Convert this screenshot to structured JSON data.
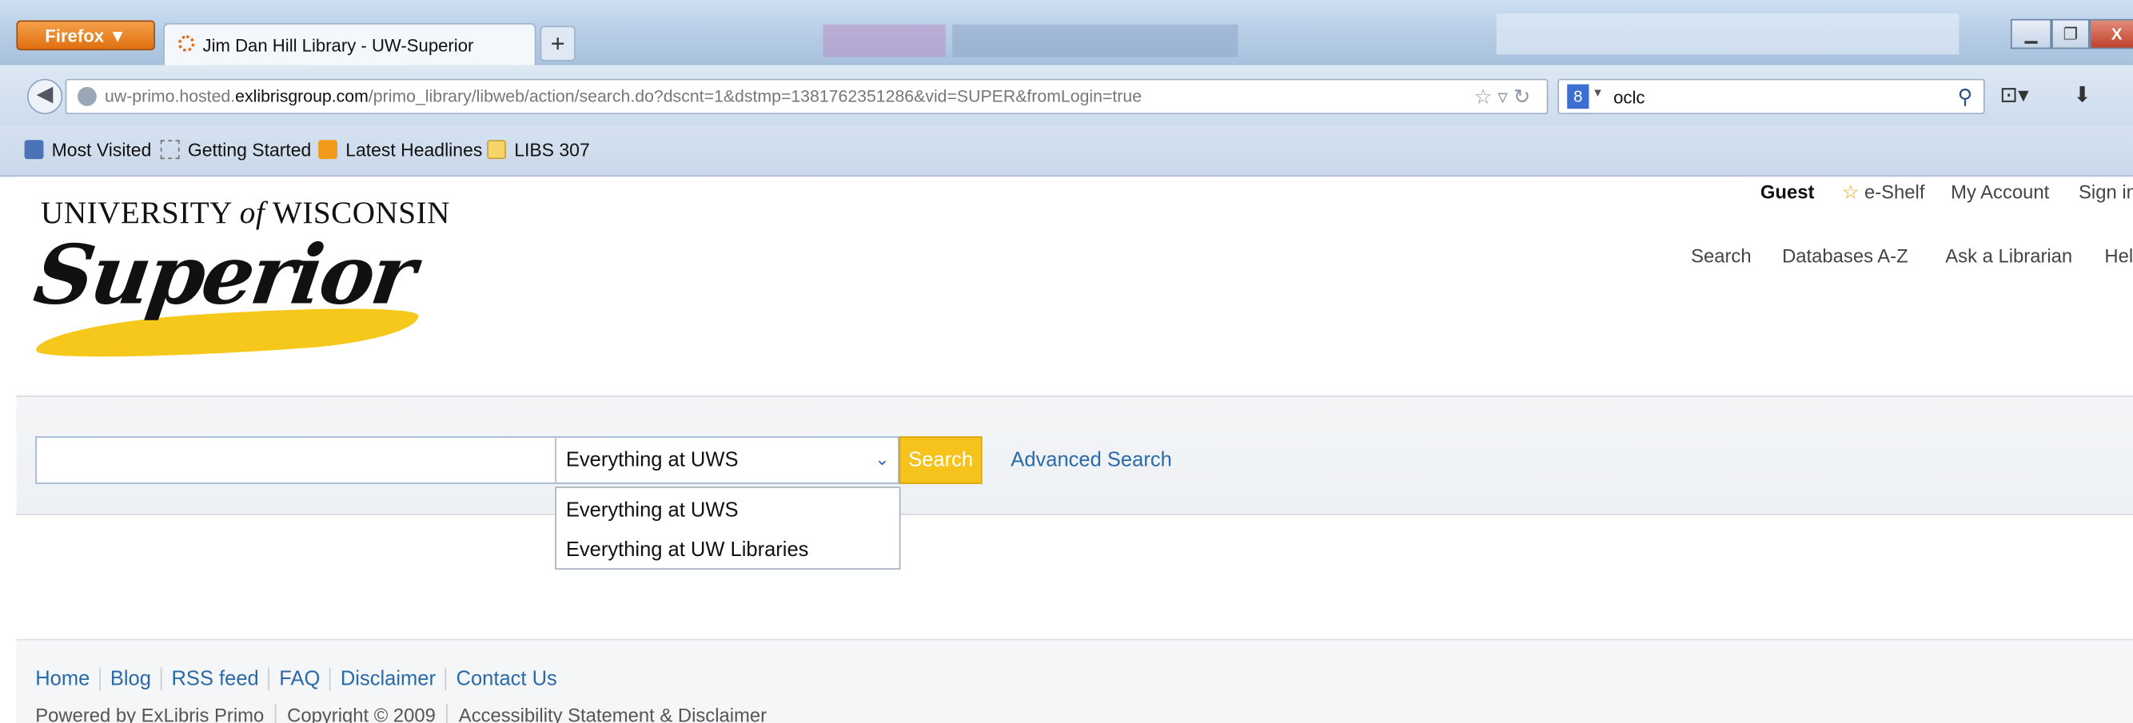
{
  "browser": {
    "menu_button": "Firefox ▼",
    "tab_title": "Jim Dan Hill Library - UW-Superior",
    "new_tab": "+",
    "url_prefix": "uw-primo.hosted.",
    "url_domain": "exlibrisgroup.com",
    "url_path": "/primo_library/libweb/action/search.do?dscnt=1&dstmp=1381762351286&vid=SUPER&fromLogin=true",
    "search_engine_icon": "google-icon",
    "search_value": "oclc",
    "window_controls": [
      "minimize",
      "restore",
      "close"
    ]
  },
  "bookmarks": [
    {
      "label": "Most Visited",
      "icon": "most-visited-icon"
    },
    {
      "label": "Getting Started",
      "icon": "page-icon"
    },
    {
      "label": "Latest Headlines",
      "icon": "rss-icon"
    },
    {
      "label": "LIBS 307",
      "icon": "folder-icon"
    }
  ],
  "logo": {
    "line1_a": "UNIVERSITY ",
    "line1_b": "of",
    "line1_c": " WISCONSIN",
    "script": "Superior",
    "brush_color": "#f6c81c"
  },
  "user_bar": {
    "guest": "Guest",
    "eshelf": "e-Shelf",
    "my_account": "My Account",
    "sign_in": "Sign in"
  },
  "top_nav": [
    "Search",
    "Databases A-Z",
    "Ask a Librarian",
    "Help"
  ],
  "search": {
    "input_value": "",
    "scope_selected": "Everything at UWS",
    "scope_options": [
      "Everything at UWS",
      "Everything at UW Libraries"
    ],
    "button": "Search",
    "advanced": "Advanced Search",
    "accent_color": "#f6c21c"
  },
  "footer": {
    "links": [
      "Home",
      "Blog",
      "RSS feed",
      "FAQ",
      "Disclaimer",
      "Contact Us"
    ],
    "copy": [
      "Powered by ExLibris Primo",
      "Copyright © 2009",
      "Accessibility Statement & Disclaimer"
    ]
  }
}
